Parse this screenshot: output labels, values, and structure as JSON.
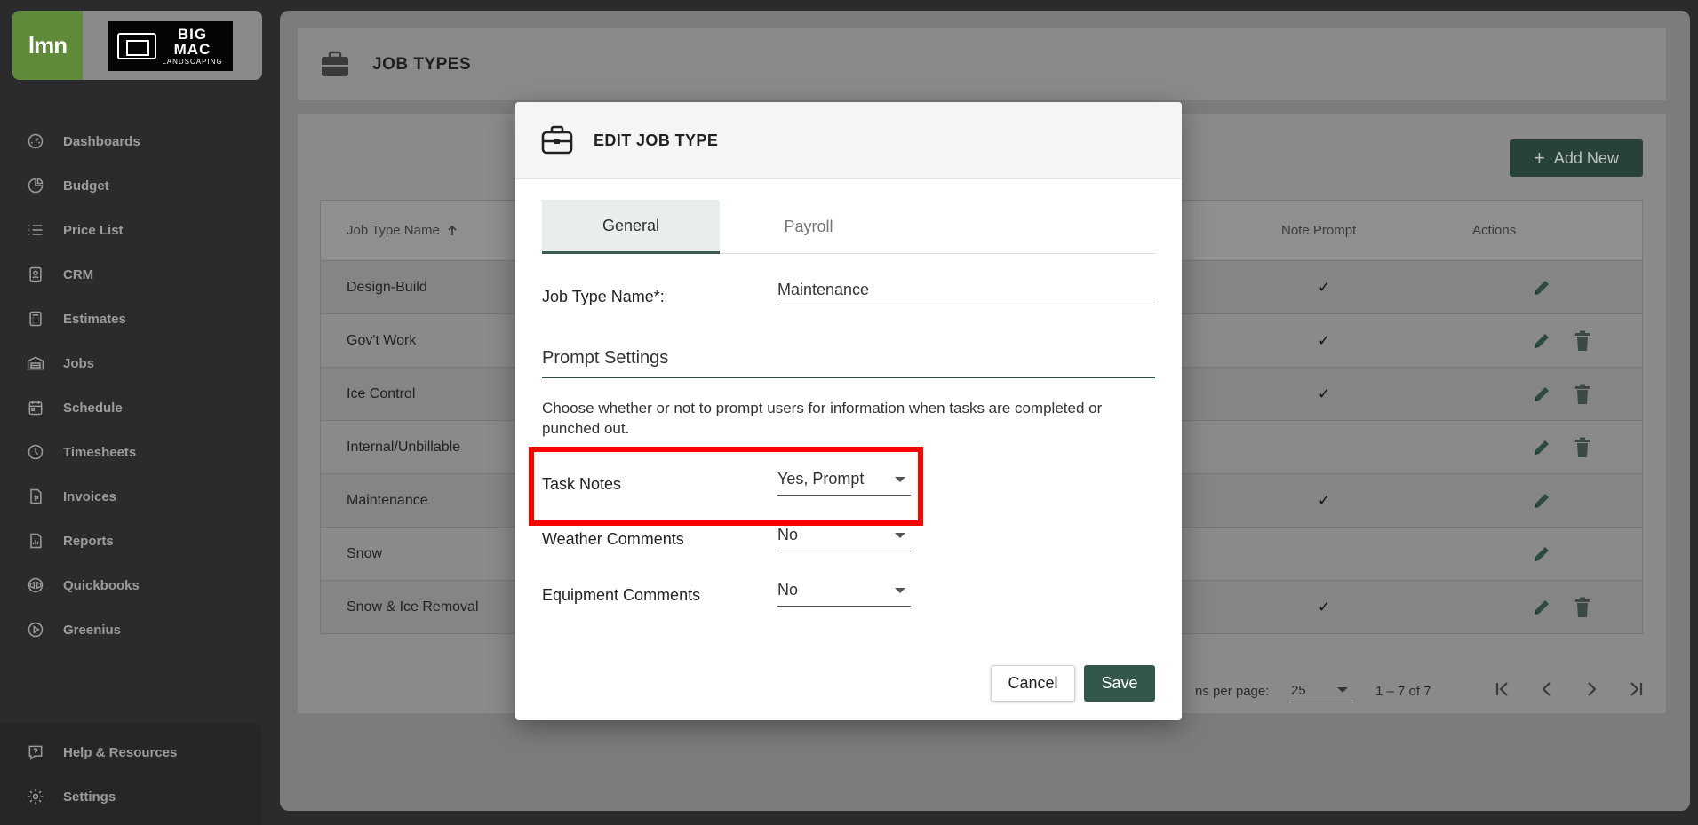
{
  "brand": {
    "app_logo_text": "lmn",
    "client_logo_line1": "BIG",
    "client_logo_line2": "MAC",
    "client_logo_line3": "LANDSCAPING"
  },
  "sidebar": {
    "items": [
      {
        "label": "Dashboards",
        "icon": "speedometer-icon"
      },
      {
        "label": "Budget",
        "icon": "pie-chart-icon"
      },
      {
        "label": "Price List",
        "icon": "list-icon"
      },
      {
        "label": "CRM",
        "icon": "contact-card-icon"
      },
      {
        "label": "Estimates",
        "icon": "calculator-icon"
      },
      {
        "label": "Jobs",
        "icon": "warehouse-icon"
      },
      {
        "label": "Schedule",
        "icon": "calendar-icon"
      },
      {
        "label": "Timesheets",
        "icon": "clock-icon"
      },
      {
        "label": "Invoices",
        "icon": "invoice-icon"
      },
      {
        "label": "Reports",
        "icon": "report-icon"
      },
      {
        "label": "Quickbooks",
        "icon": "quickbooks-icon"
      },
      {
        "label": "Greenius",
        "icon": "play-circle-icon"
      }
    ],
    "footer_items": [
      {
        "label": "Help & Resources",
        "icon": "help-icon"
      },
      {
        "label": "Settings",
        "icon": "gear-icon"
      }
    ]
  },
  "page": {
    "title": "JOB TYPES",
    "add_new_label": "Add New",
    "table": {
      "columns": [
        "Job Type Name",
        "Note Prompt",
        "Actions"
      ],
      "rows": [
        {
          "name": "Design-Build",
          "note_prompt": "✓",
          "deletable": false
        },
        {
          "name": "Gov't Work",
          "note_prompt": "✓",
          "deletable": true
        },
        {
          "name": "Ice Control",
          "note_prompt": "✓",
          "deletable": true
        },
        {
          "name": "Internal/Unbillable",
          "note_prompt": "",
          "deletable": true
        },
        {
          "name": "Maintenance",
          "note_prompt": "✓",
          "deletable": false
        },
        {
          "name": "Snow",
          "note_prompt": "",
          "deletable": false
        },
        {
          "name": "Snow & Ice Removal",
          "note_prompt": "✓",
          "deletable": true
        }
      ]
    },
    "pager": {
      "per_page_label": "ns per page:",
      "per_page_value": "25",
      "range": "1 – 7 of 7"
    }
  },
  "modal": {
    "title": "EDIT JOB TYPE",
    "tabs": [
      "General",
      "Payroll"
    ],
    "active_tab": "General",
    "job_type_name_label": "Job Type Name*:",
    "job_type_name_value": "Maintenance",
    "section_title": "Prompt Settings",
    "description": "Choose whether or not to prompt users for information when tasks are completed or punched out.",
    "prompts": [
      {
        "label": "Task Notes",
        "value": "Yes, Prompt"
      },
      {
        "label": "Weather Comments",
        "value": "No"
      },
      {
        "label": "Equipment Comments",
        "value": "No"
      }
    ],
    "cancel_label": "Cancel",
    "save_label": "Save"
  },
  "colors": {
    "brand_green": "#5f8a3a",
    "primary_dark_green": "#33574a",
    "highlight_red": "#ff0000",
    "sidebar_bg": "#2b2b2d"
  }
}
